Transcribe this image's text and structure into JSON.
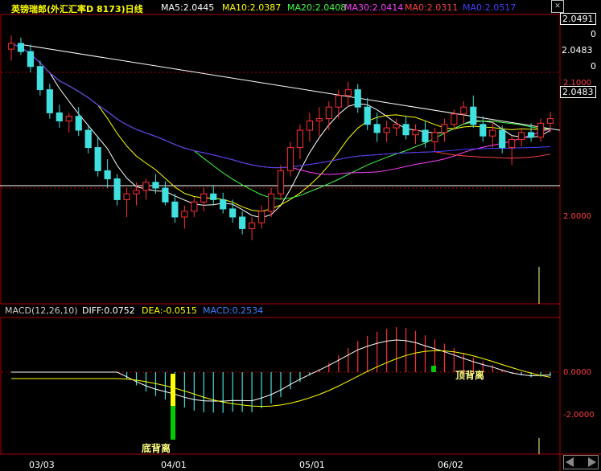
{
  "header": {
    "title": "英镑瑞郎(外汇汇率D 8173)日线",
    "ma5": "MA5:2.0445",
    "ma10": "MA10:2.0387",
    "ma20": "MA20:2.0408",
    "ma30": "MA30:2.0414",
    "ma0a": "MA0:2.0311",
    "ma0b": "MA0:2.0517"
  },
  "price_axis": {
    "p1": "2.0491",
    "p1b": "0",
    "p2": "2.0483",
    "p2b": "0",
    "p3": "2.0483",
    "p4": "2.1000",
    "p5": "2.0000"
  },
  "macd": {
    "label": "MACD(12,26,10)",
    "diff": "DIFF:0.0752",
    "dea": "DEA:-0.0515",
    "value": "MACD:0.2534",
    "axis_zero": "0.0000",
    "axis_neg": "-2.0000"
  },
  "dates": [
    "03/03",
    "04/01",
    "05/01",
    "06/02"
  ],
  "annotations": {
    "bottom_divergence": "底背离",
    "top_divergence": "顶背离"
  },
  "colors": {
    "up": "#ff3030",
    "down": "#40e0e0",
    "ma5": "#ffffff",
    "ma10": "#ffff00",
    "ma20": "#40ff40",
    "ma30": "#ff40ff",
    "ma0a": "#ff4040",
    "ma0b": "#4040ff"
  },
  "chart_data": {
    "type": "candlestick",
    "ylim": [
      1.9,
      2.15
    ],
    "candles": [
      [
        2.12,
        2.132,
        2.11,
        2.125
      ],
      [
        2.125,
        2.13,
        2.115,
        2.118
      ],
      [
        2.118,
        2.124,
        2.1,
        2.105
      ],
      [
        2.105,
        2.11,
        2.08,
        2.085
      ],
      [
        2.085,
        2.09,
        2.06,
        2.065
      ],
      [
        2.065,
        2.072,
        2.052,
        2.058
      ],
      [
        2.058,
        2.065,
        2.048,
        2.062
      ],
      [
        2.062,
        2.07,
        2.045,
        2.05
      ],
      [
        2.05,
        2.055,
        2.03,
        2.035
      ],
      [
        2.035,
        2.045,
        2.01,
        2.015
      ],
      [
        2.015,
        2.025,
        2.0,
        2.008
      ],
      [
        2.008,
        2.012,
        1.985,
        1.99
      ],
      [
        1.99,
        2.0,
        1.975,
        1.995
      ],
      [
        1.995,
        2.005,
        1.985,
        1.998
      ],
      [
        1.998,
        2.008,
        1.99,
        2.005
      ],
      [
        2.005,
        2.012,
        1.995,
        2.0
      ],
      [
        2.0,
        2.006,
        1.985,
        1.988
      ],
      [
        1.988,
        1.995,
        1.97,
        1.975
      ],
      [
        1.975,
        1.985,
        1.965,
        1.98
      ],
      [
        1.98,
        1.992,
        1.975,
        1.988
      ],
      [
        1.988,
        2.0,
        1.98,
        1.995
      ],
      [
        1.995,
        2.002,
        1.985,
        1.99
      ],
      [
        1.99,
        1.996,
        1.978,
        1.982
      ],
      [
        1.982,
        1.99,
        1.97,
        1.975
      ],
      [
        1.975,
        1.98,
        1.96,
        1.965
      ],
      [
        1.965,
        1.975,
        1.955,
        1.97
      ],
      [
        1.97,
        1.985,
        1.965,
        1.98
      ],
      [
        1.98,
        2.0,
        1.975,
        1.995
      ],
      [
        1.995,
        2.02,
        1.99,
        2.015
      ],
      [
        2.015,
        2.04,
        2.01,
        2.035
      ],
      [
        2.035,
        2.055,
        2.025,
        2.05
      ],
      [
        2.05,
        2.065,
        2.04,
        2.058
      ],
      [
        2.058,
        2.07,
        2.045,
        2.06
      ],
      [
        2.06,
        2.075,
        2.05,
        2.07
      ],
      [
        2.07,
        2.085,
        2.06,
        2.08
      ],
      [
        2.08,
        2.092,
        2.07,
        2.085
      ],
      [
        2.085,
        2.09,
        2.065,
        2.07
      ],
      [
        2.07,
        2.078,
        2.05,
        2.055
      ],
      [
        2.055,
        2.065,
        2.04,
        2.048
      ],
      [
        2.048,
        2.058,
        2.04,
        2.052
      ],
      [
        2.052,
        2.06,
        2.045,
        2.055
      ],
      [
        2.055,
        2.062,
        2.042,
        2.046
      ],
      [
        2.046,
        2.055,
        2.038,
        2.05
      ],
      [
        2.05,
        2.058,
        2.035,
        2.04
      ],
      [
        2.04,
        2.052,
        2.032,
        2.048
      ],
      [
        2.048,
        2.06,
        2.04,
        2.055
      ],
      [
        2.055,
        2.068,
        2.05,
        2.064
      ],
      [
        2.064,
        2.075,
        2.055,
        2.07
      ],
      [
        2.07,
        2.08,
        2.052,
        2.055
      ],
      [
        2.055,
        2.062,
        2.04,
        2.045
      ],
      [
        2.045,
        2.058,
        2.035,
        2.05
      ],
      [
        2.05,
        2.054,
        2.03,
        2.035
      ],
      [
        2.035,
        2.045,
        2.02,
        2.042
      ],
      [
        2.042,
        2.052,
        2.036,
        2.048
      ],
      [
        2.048,
        2.056,
        2.04,
        2.044
      ],
      [
        2.044,
        2.06,
        2.04,
        2.056
      ],
      [
        2.056,
        2.066,
        2.048,
        2.06
      ]
    ]
  }
}
